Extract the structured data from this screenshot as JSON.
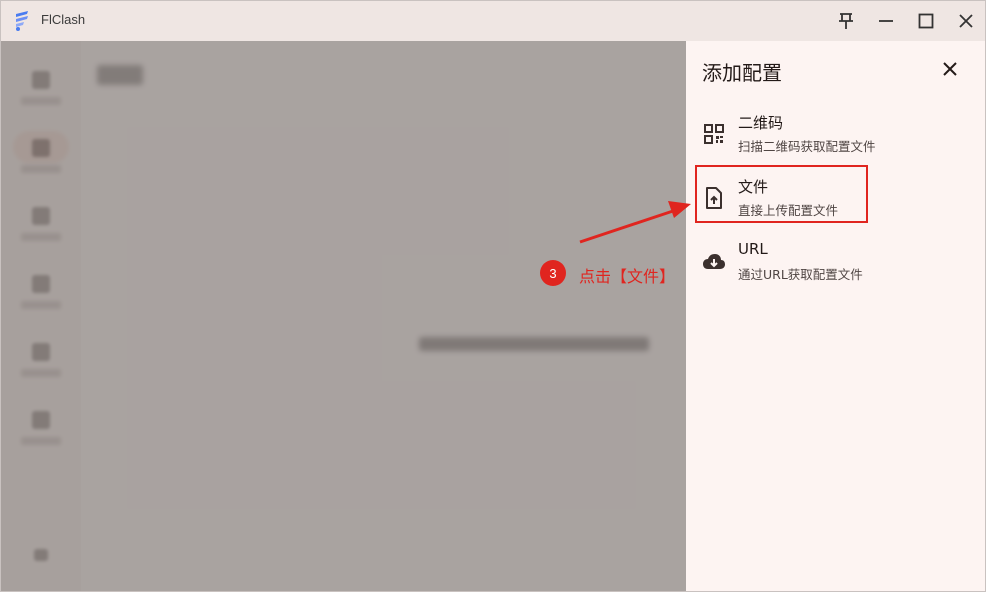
{
  "window": {
    "title": "FlClash",
    "pin_icon": "pin-icon",
    "minimize_icon": "minimize-icon",
    "maximize_icon": "maximize-icon",
    "close_icon": "close-icon"
  },
  "sheet": {
    "title": "添加配置",
    "options": [
      {
        "title": "二维码",
        "subtitle": "扫描二维码获取配置文件",
        "icon": "qr-code-icon"
      },
      {
        "title": "文件",
        "subtitle": "直接上传配置文件",
        "icon": "file-upload-icon"
      },
      {
        "title": "URL",
        "subtitle": "通过URL获取配置文件",
        "icon": "cloud-download-icon"
      }
    ]
  },
  "annotation": {
    "step_number": "3",
    "step_text": "点击【文件】",
    "color": "#e0251f"
  },
  "colors": {
    "sheet_bg": "#fdf4f2",
    "title_bar_bg": "#efe6e3",
    "scrim": "#8c8684"
  }
}
